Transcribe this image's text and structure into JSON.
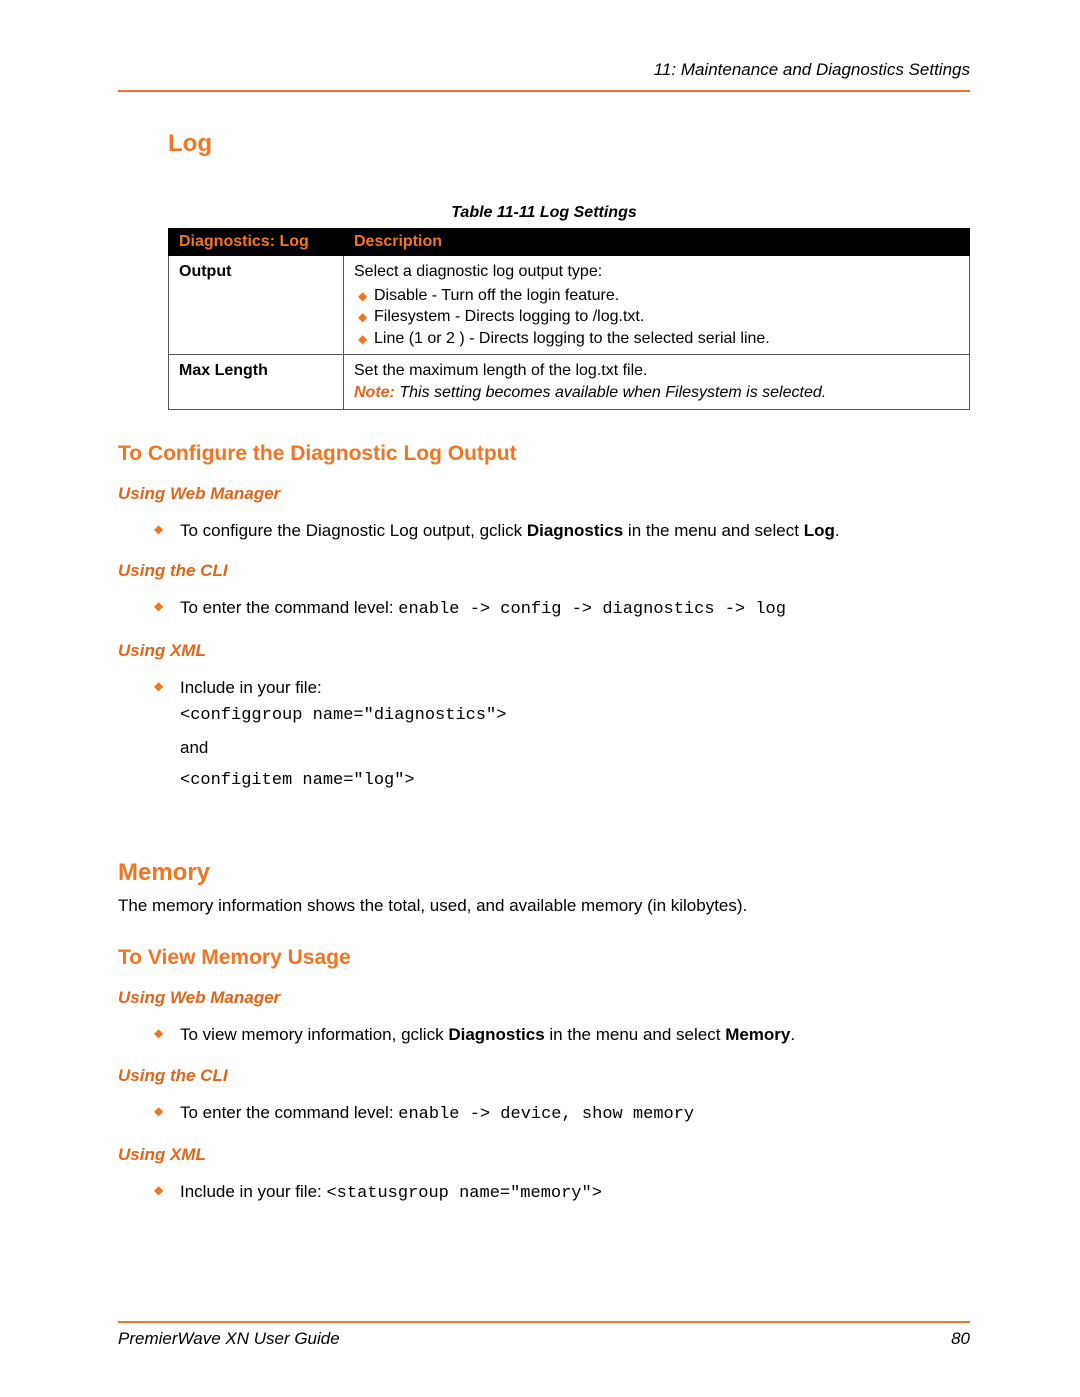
{
  "header": {
    "running_head": "11: Maintenance and Diagnostics Settings"
  },
  "footer": {
    "guide": "PremierWave XN User Guide",
    "page": "80"
  },
  "sections": {
    "log_heading": "Log",
    "table_caption": "Table 11-11  Log Settings",
    "table": {
      "head_col1": "Diagnostics: Log",
      "head_col2": "Description",
      "row1_label": "Output",
      "row1_intro": "Select a diagnostic log output type:",
      "row1_items": [
        "Disable - Turn off the login feature.",
        "Filesystem - Directs logging to /log.txt.",
        "Line (1 or 2 ) - Directs logging to the selected serial line."
      ],
      "row2_label": "Max Length",
      "row2_text": "Set the maximum length of the log.txt file.",
      "row2_note_label": "Note:",
      "row2_note_body": " This setting becomes available when Filesystem is selected."
    },
    "config_heading": "To Configure the Diagnostic Log Output",
    "web1_label": "Using Web Manager",
    "web1_pre": "To configure the Diagnostic Log output, gclick ",
    "web1_bold1": "Diagnostics",
    "web1_mid": " in the menu and select ",
    "web1_bold2": "Log",
    "web1_post": ".",
    "cli1_label": "Using the CLI",
    "cli1_pre": "To enter the command level: ",
    "cli1_cmd": "enable -> config -> diagnostics -> log",
    "xml1_label": "Using XML",
    "xml1_pre": "Include in your file:",
    "xml1_line1": "<configgroup name=\"diagnostics\">",
    "xml1_and": "and",
    "xml1_line2": "<configitem name=\"log\">",
    "memory_heading": "Memory",
    "memory_para": "The memory information shows the total, used, and available memory (in kilobytes).",
    "view_heading": "To View Memory Usage",
    "web2_label": "Using Web Manager",
    "web2_pre": "To view memory information, gclick ",
    "web2_bold1": "Diagnostics",
    "web2_mid": " in the menu and select ",
    "web2_bold2": "Memory",
    "web2_post": ".",
    "cli2_label": "Using the CLI",
    "cli2_pre": "To enter the command level: ",
    "cli2_cmd": "enable -> device, show memory",
    "xml2_label": "Using XML",
    "xml2_pre": "Include in your file: ",
    "xml2_code": "<statusgroup name=\"memory\">"
  }
}
